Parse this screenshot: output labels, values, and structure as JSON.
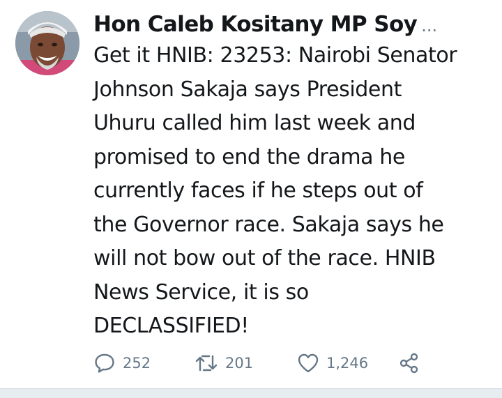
{
  "tweet": {
    "author": "Hon Caleb Kositany MP Soy",
    "more": "...",
    "text_lines": [
      "Get it HNIB: 23253: Nairobi Senator",
      "Johnson Sakaja says President",
      "Uhuru called him last week and",
      "promised to end the drama he",
      "currently faces if he steps out of",
      "the Governor race. Sakaja says he",
      "will not bow out of the race. HNIB",
      "News Service, it is so",
      "DECLASSIFIED!"
    ],
    "actions": {
      "replies": "252",
      "retweets": "201",
      "likes": "1,246"
    },
    "icons": {
      "reply": "speech-bubble-icon",
      "retweet": "retweet-arrows-icon",
      "like": "heart-icon",
      "share": "share-icon"
    },
    "colors": {
      "text": "#14171a",
      "secondary": "#657786",
      "divider": "#e6ecf0"
    }
  }
}
